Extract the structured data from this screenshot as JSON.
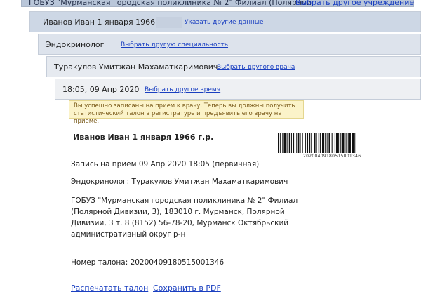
{
  "header": {
    "institution": "ГОБУЗ \"Мурманская городская поликлиника № 2\" Филиал (Полярной",
    "change_institution": "Выбрать другое учреждение"
  },
  "patient_row": {
    "name": "Иванов Иван 1 января 1966 г.р.",
    "link": "Указать другие данные"
  },
  "specialty_row": {
    "name": "Эндокринолог",
    "link": "Выбрать другую специальность"
  },
  "doctor_row": {
    "name": "Туракулов Умитжан Махаматкаримович",
    "link": "Выбрать другого врача"
  },
  "time_row": {
    "name": "18:05, 09 Апр 2020",
    "link": "Выбрать другое время"
  },
  "notice": {
    "line1": "Вы успешно записаны на прием к врачу. Теперь вы должны получить",
    "line2": "статистический талон в регистратуре и предъявить его врачу на приеме."
  },
  "ticket": {
    "patient": "Иванов Иван  1 января  1966 г.р.",
    "barcode_number": "20200409180515001346",
    "appointment": "Запись на приём 09 Апр 2020 18:05 (первичная)",
    "doctor": "Эндокринолог: Туракулов Умитжан Махаматкаримович",
    "address_lines": [
      "ГОБУЗ \"Мурманская городская поликлиника № 2\" Филиал",
      "(Полярной Дивизии, 3), 183010 г. Мурманск, Полярной",
      "Дивизии, 3 т. 8 (8152) 56-78-20, Мурманск Октябрьский",
      "административный округ р-н"
    ],
    "ticket_number": "Номер талона: 20200409180515001346"
  },
  "actions": {
    "print": "Распечатать талон",
    "pdf": "Сохранить в PDF"
  },
  "colors": {
    "link": "#1a3fc0",
    "notice_bg": "#fbf3c9",
    "notice_text": "#7a5a1a"
  }
}
